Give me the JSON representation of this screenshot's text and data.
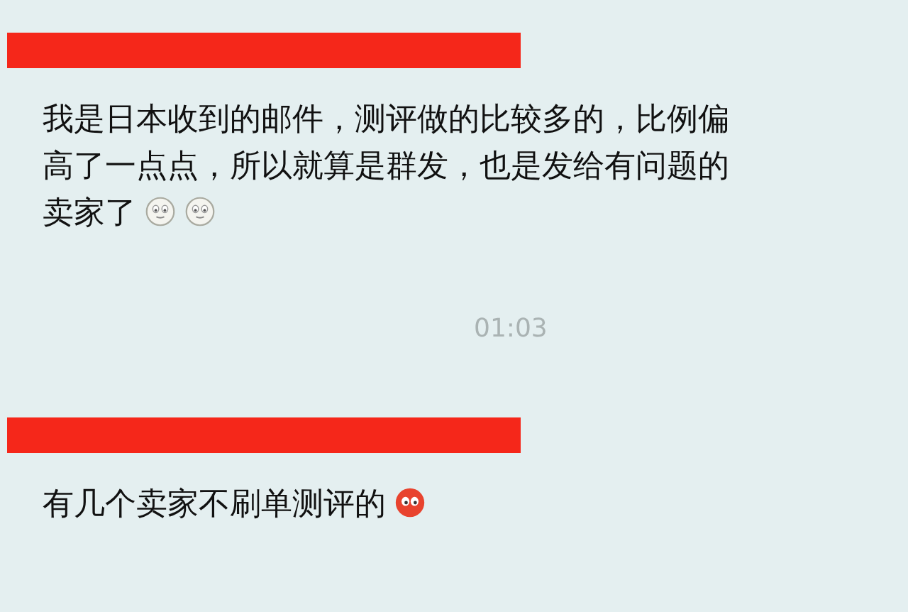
{
  "items": [
    {
      "kind": "message",
      "text": "我是日本收到的邮件，测评做的比较多的，比例偏高了一点点，所以就算是群发，也是发给有问题的卖家了",
      "emojis": [
        {
          "kind": "pale"
        },
        {
          "kind": "pale"
        }
      ]
    },
    {
      "kind": "time",
      "text": "01:03"
    },
    {
      "kind": "message",
      "text": "有几个卖家不刷单测评的",
      "emojis": [
        {
          "kind": "red"
        }
      ]
    }
  ]
}
